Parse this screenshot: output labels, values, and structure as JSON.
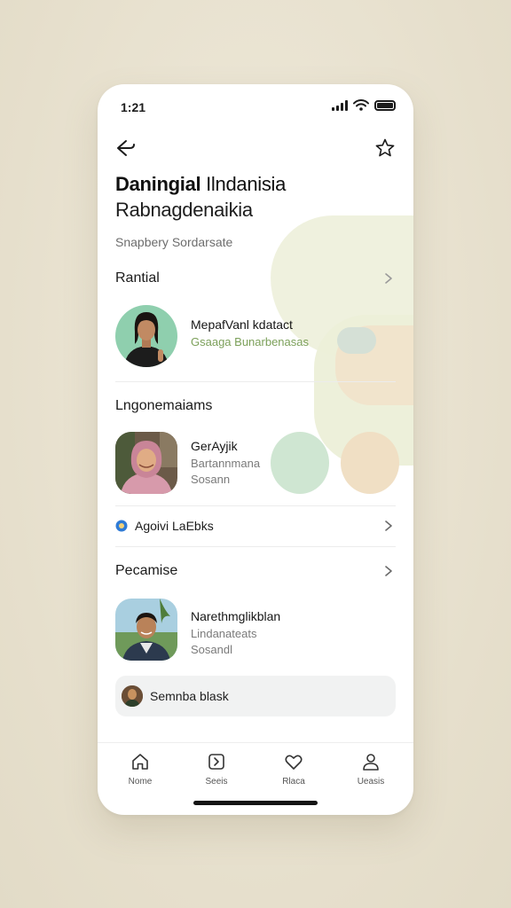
{
  "status_bar": {
    "time": "1:21"
  },
  "header": {
    "title_bold": "Daningial",
    "title_rest": " Ilndanisia",
    "title_line2": "Rabnagdenaikia",
    "subtitle": "Snapbery Sordarsate"
  },
  "section_1": {
    "title": "Rantial",
    "person": {
      "name": "MepafVanl kdatact",
      "detail": "Gsaaga Bunarbenasas"
    }
  },
  "section_2": {
    "title": "Lngonemaiams",
    "person": {
      "name": "GerAyjik",
      "line1": "Bartannmana",
      "line2": "Sosann"
    }
  },
  "verified_row": {
    "label": "Agoivi LaEbks"
  },
  "section_3": {
    "title": "Pecamise",
    "person": {
      "name": "Narethmglikblan",
      "line1": "Lindanateats",
      "line2": "Sosandl"
    }
  },
  "search_pill": {
    "label": "Semnba blask"
  },
  "tabs": [
    {
      "label": "Nome",
      "icon": "home-icon"
    },
    {
      "label": "Seeis",
      "icon": "share-icon"
    },
    {
      "label": "Rlaca",
      "icon": "heart-icon"
    },
    {
      "label": "Ueasis",
      "icon": "user-icon"
    }
  ],
  "colors": {
    "background": "#e8e2d0",
    "card": "#ffffff",
    "accent_green": "#7ca05a",
    "verified_blue": "#2f7bd6"
  }
}
